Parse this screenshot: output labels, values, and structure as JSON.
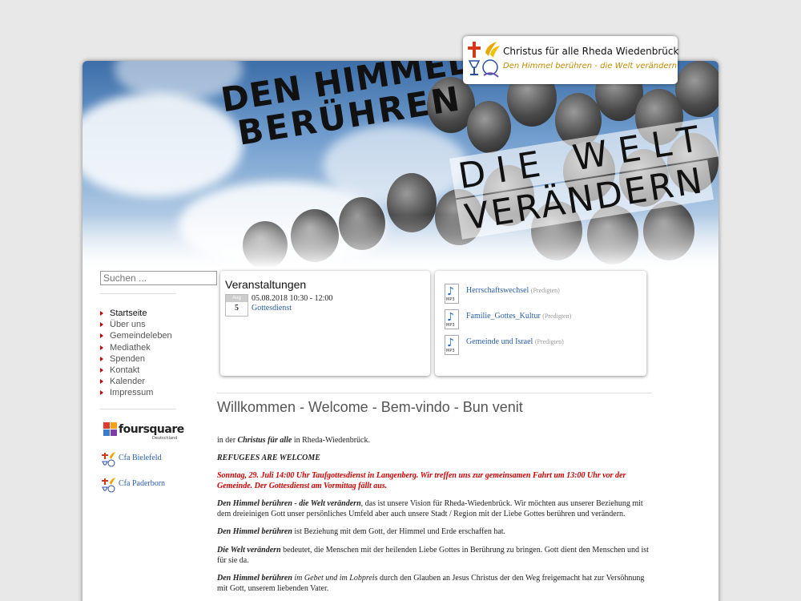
{
  "logo": {
    "title": "Christus für alle Rheda Wiedenbrück",
    "subtitle": "Den Himmel berühren - die Welt verändern"
  },
  "banner": {
    "line1": "DEN HIMMEL",
    "line2": "BERÜHREN",
    "line3": "DIE WELT",
    "line4": "VERÄNDERN"
  },
  "search": {
    "placeholder": "Suchen ..."
  },
  "nav": {
    "items": [
      {
        "label": "Startseite"
      },
      {
        "label": "Über uns"
      },
      {
        "label": "Gemeindeleben"
      },
      {
        "label": "Mediathek"
      },
      {
        "label": "Spenden"
      },
      {
        "label": "Kontakt"
      },
      {
        "label": "Kalender"
      },
      {
        "label": "Impressum"
      }
    ]
  },
  "foursquare": {
    "label": "foursquare",
    "sub": "Deutschland"
  },
  "links": {
    "bielefeld": "Cfa Bielefeld",
    "paderborn": "Cfa Paderborn"
  },
  "events": {
    "title": "Veranstaltungen",
    "month": "Aug",
    "day": "5",
    "time": "05.08.2018 10:30 - 12:00",
    "name": "Gottesdienst"
  },
  "media": {
    "icon_label": "MP3",
    "items": [
      {
        "title": "Herrschaftswechsel",
        "category": "(Predigten)"
      },
      {
        "title": "Familie_Gottes_Kultur",
        "category": "(Predigten)"
      },
      {
        "title": "Gemeinde und Israel",
        "category": "(Predigten)"
      }
    ]
  },
  "welcome": "Willkommen - Welcome - Bem-vindo - Bun venit",
  "content": {
    "intro_pre": "in der ",
    "intro_bold": "Christus für alle",
    "intro_post": " in Rheda-Wiedenbrück.",
    "refugees": "REFUGEES ARE WELCOME",
    "notice": "Sonntag, 29. Juli 14:00 Uhr Taufgottesdienst in Langenberg. Wir treffen uns zur gemeinsamen Fahrt um 13:00 Uhr vor der Gemeinde. Der Gottesdienst am Vormittag fällt aus.",
    "p1_bold": "Den Himmel berühren - die Welt verändern",
    "p1_rest": ", das ist unsere Vision für Rheda-Wiedenbrück. Wir möchten aus unserer Beziehung mit dem dreieinigen Gott unser persönliches Umfeld aber auch unsere Stadt / Region mit der Liebe Gottes berühren und verändern.",
    "p2_bold": "Den Himmel berühren",
    "p2_rest": " ist Beziehung mit dem Gott, der Himmel und Erde erschaffen hat.",
    "p3_bold": "Die Welt verändern",
    "p3_rest": " bedeutet, die Menschen mit der heilenden Liebe Gottes in Berührung zu bringen. Gott dient den Menschen und ist für sie da.",
    "p4_bold": "Den Himmel berühren",
    "p4_italic": " im Gebet und im Lobpreis",
    "p4_rest": " durch den Glauben an Jesus Christus der den Weg freigemacht hat zur Versöhnung mit Gott, unserem liebenden Vater."
  }
}
